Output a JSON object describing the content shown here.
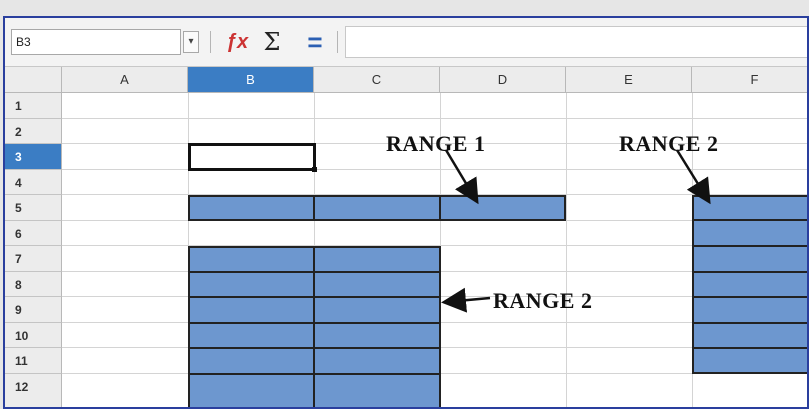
{
  "formula_bar": {
    "name_box": "B3",
    "name_box_dropdown_icon": "chevron-down-icon",
    "function_wizard_icon": "function-wizard-icon",
    "sum_symbol": "Σ",
    "equals_symbol": "=",
    "formula_value": ""
  },
  "columns": [
    "A",
    "B",
    "C",
    "D",
    "E",
    "F"
  ],
  "active_column": "B",
  "rows": [
    "1",
    "2",
    "3",
    "4",
    "5",
    "6",
    "7",
    "8",
    "9",
    "10",
    "11",
    "12"
  ],
  "active_row": "3",
  "annotations": {
    "range1": "RANGE 1",
    "range2_top": "RANGE 2",
    "range2_side": "RANGE 2"
  },
  "colors": {
    "selection_fill": "#6d97cf",
    "header_active": "#3b7dc4",
    "frame_border": "#2a3f9e"
  }
}
